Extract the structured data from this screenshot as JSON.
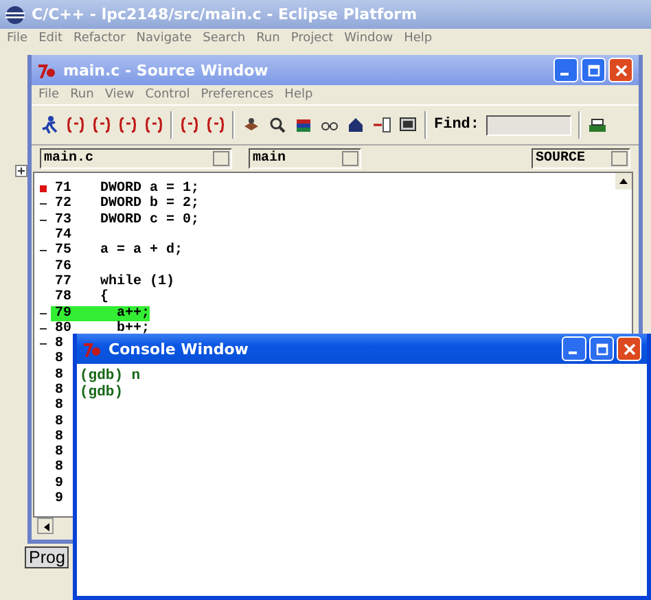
{
  "eclipse": {
    "title": "C/C++ - lpc2148/src/main.c - Eclipse Platform",
    "menu": [
      "File",
      "Edit",
      "Refactor",
      "Navigate",
      "Search",
      "Run",
      "Project",
      "Window",
      "Help"
    ],
    "bottom_tab": "Prog"
  },
  "source_window": {
    "title": "main.c - Source Window",
    "menu": [
      "File",
      "Run",
      "View",
      "Control",
      "Preferences",
      "Help"
    ],
    "find_label": "Find:",
    "file_combo": "main.c",
    "function_combo": "main",
    "mode_combo": "SOURCE",
    "lines": [
      {
        "number": "71",
        "code": "DWORD a = 1;",
        "kind": "breakpoint",
        "current": false
      },
      {
        "number": "72",
        "code": "DWORD b = 2;",
        "kind": "executable",
        "current": false
      },
      {
        "number": "73",
        "code": "DWORD c = 0;",
        "kind": "executable",
        "current": false
      },
      {
        "number": "74",
        "kind": "plain",
        "current": false
      },
      {
        "number": "75",
        "code": "a = a + d;",
        "kind": "executable",
        "current": false
      },
      {
        "number": "76",
        "kind": "plain",
        "current": false
      },
      {
        "number": "77",
        "code": "while (1)",
        "kind": "plain",
        "current": false
      },
      {
        "number": "78",
        "code": "{",
        "kind": "plain",
        "current": false
      },
      {
        "number": "79",
        "code": "  a++;",
        "kind": "executable",
        "current": true
      },
      {
        "number": "80",
        "code": "  b++;",
        "kind": "executable",
        "current": false
      },
      {
        "number": "8",
        "kind": "executable",
        "current": false
      },
      {
        "number": "8",
        "kind": "plain",
        "current": false
      },
      {
        "number": "8",
        "kind": "plain",
        "current": false
      },
      {
        "number": "8",
        "kind": "plain",
        "current": false
      },
      {
        "number": "8",
        "kind": "plain",
        "current": false
      },
      {
        "number": "8",
        "kind": "plain",
        "current": false
      },
      {
        "number": "8",
        "kind": "plain",
        "current": false
      },
      {
        "number": "8",
        "kind": "plain",
        "current": false
      },
      {
        "number": "8",
        "kind": "plain",
        "current": false
      },
      {
        "number": "9",
        "kind": "plain",
        "current": false
      },
      {
        "number": "9",
        "kind": "plain",
        "current": false
      }
    ]
  },
  "console_window": {
    "title": "Console Window",
    "lines": [
      "(gdb) n",
      "(gdb)"
    ]
  }
}
